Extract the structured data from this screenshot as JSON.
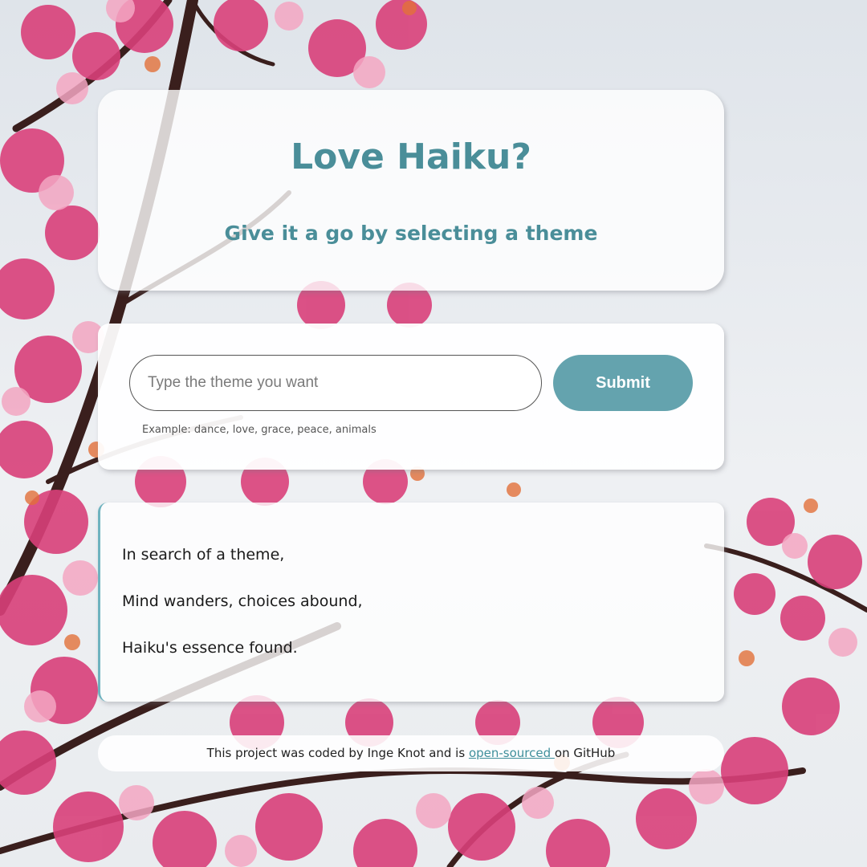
{
  "hero": {
    "title": "Love Haiku?",
    "subtitle": "Give it a go by selecting a theme"
  },
  "form": {
    "placeholder": "Type the theme you want",
    "value": "",
    "submit_label": "Submit",
    "example": "Example: dance, love, grace, peace, animals"
  },
  "poem": {
    "lines": [
      "In search of a theme,",
      "Mind wanders, choices abound,",
      "Haiku's essence found."
    ]
  },
  "footer": {
    "prefix": "This project was coded by Inge Knot and is ",
    "link_text": "open-sourced ",
    "suffix": "on GitHub"
  },
  "colors": {
    "accent": "#4a8e99",
    "button": "#64a3ae",
    "blossom": "#d9407a"
  },
  "background_image": "cherry-blossom-branches"
}
